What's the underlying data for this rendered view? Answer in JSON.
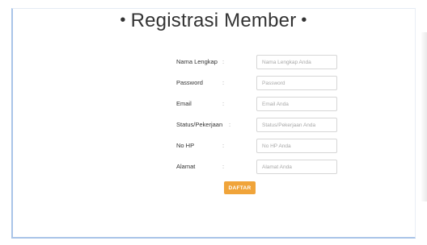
{
  "header": {
    "bullet_left": "•",
    "title": "Registrasi Member",
    "bullet_right": "•"
  },
  "form": {
    "fields": [
      {
        "label": "Nama Lengkap",
        "colon": ":",
        "placeholder": "Nama Lengkap Anda",
        "value": ""
      },
      {
        "label": "Password",
        "colon": ":",
        "placeholder": "Password",
        "value": ""
      },
      {
        "label": "Email",
        "colon": ":",
        "placeholder": "Email Anda",
        "value": ""
      },
      {
        "label": "Status/Pekerjaan",
        "colon": ":",
        "placeholder": "Status/Pekerjaan Anda",
        "value": ""
      },
      {
        "label": "No HP",
        "colon": ":",
        "placeholder": "No HP Anda",
        "value": ""
      },
      {
        "label": "Alamat",
        "colon": ":",
        "placeholder": "Alamat Anda",
        "value": ""
      }
    ],
    "submit_label": "DAFTAR"
  },
  "colors": {
    "accent_button": "#f0a43a",
    "card_border": "#a9c4e8"
  }
}
